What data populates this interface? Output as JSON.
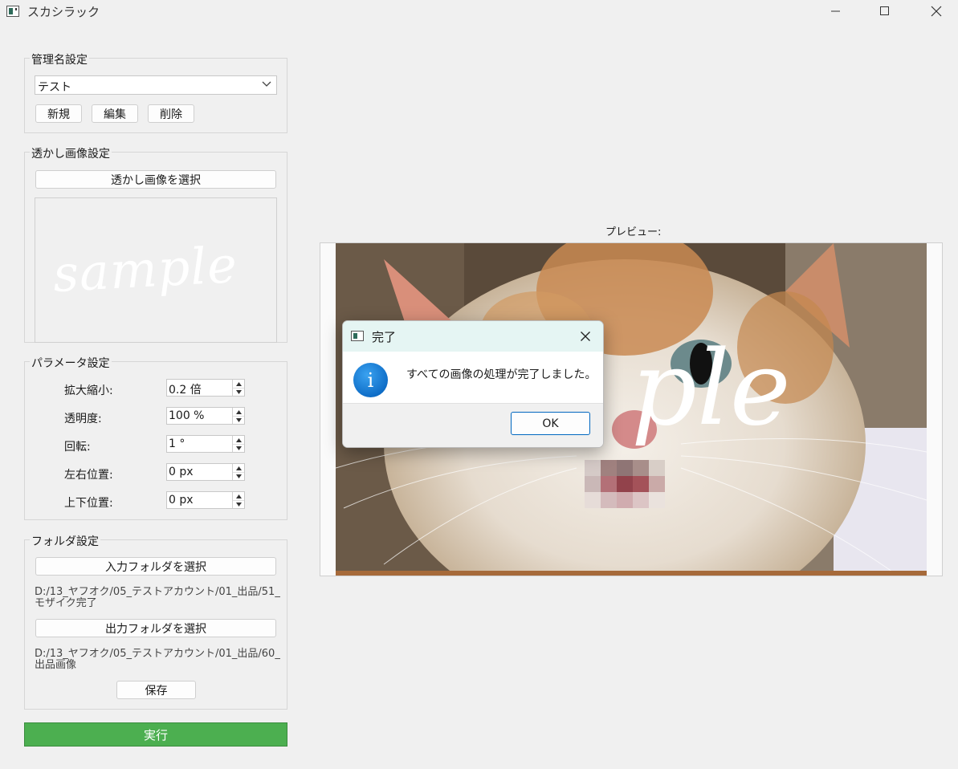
{
  "window": {
    "title": "スカシラック"
  },
  "manager": {
    "group_title": "管理名設定",
    "selected": "テスト",
    "new_label": "新規",
    "edit_label": "編集",
    "delete_label": "削除"
  },
  "watermark": {
    "group_title": "透かし画像設定",
    "select_label": "透かし画像を選択",
    "preview_text": "sample"
  },
  "params": {
    "group_title": "パラメータ設定",
    "items": [
      {
        "label": "拡大縮小:",
        "value": "0.2 倍"
      },
      {
        "label": "透明度:",
        "value": "100 %"
      },
      {
        "label": "回転:",
        "value": "1 °"
      },
      {
        "label": "左右位置:",
        "value": "0 px"
      },
      {
        "label": "上下位置:",
        "value": "0 px"
      }
    ]
  },
  "folders": {
    "group_title": "フォルダ設定",
    "input_label": "入力フォルダを選択",
    "input_path": "D:/13_ヤフオク/05_テストアカウント/01_出品/51_モザイク完了",
    "output_label": "出力フォルダを選択",
    "output_path": "D:/13_ヤフオク/05_テストアカウント/01_出品/60_出品画像",
    "save_label": "保存"
  },
  "run_label": "実行",
  "preview": {
    "label": "プレビュー:",
    "overlay_text": "ple"
  },
  "dialog": {
    "title": "完了",
    "message": "すべての画像の処理が完了しました。",
    "ok_label": "OK"
  },
  "colors": {
    "run_button": "#4caf50",
    "dialog_title_bg": "#e5f5f3",
    "ok_border": "#0067c0"
  }
}
